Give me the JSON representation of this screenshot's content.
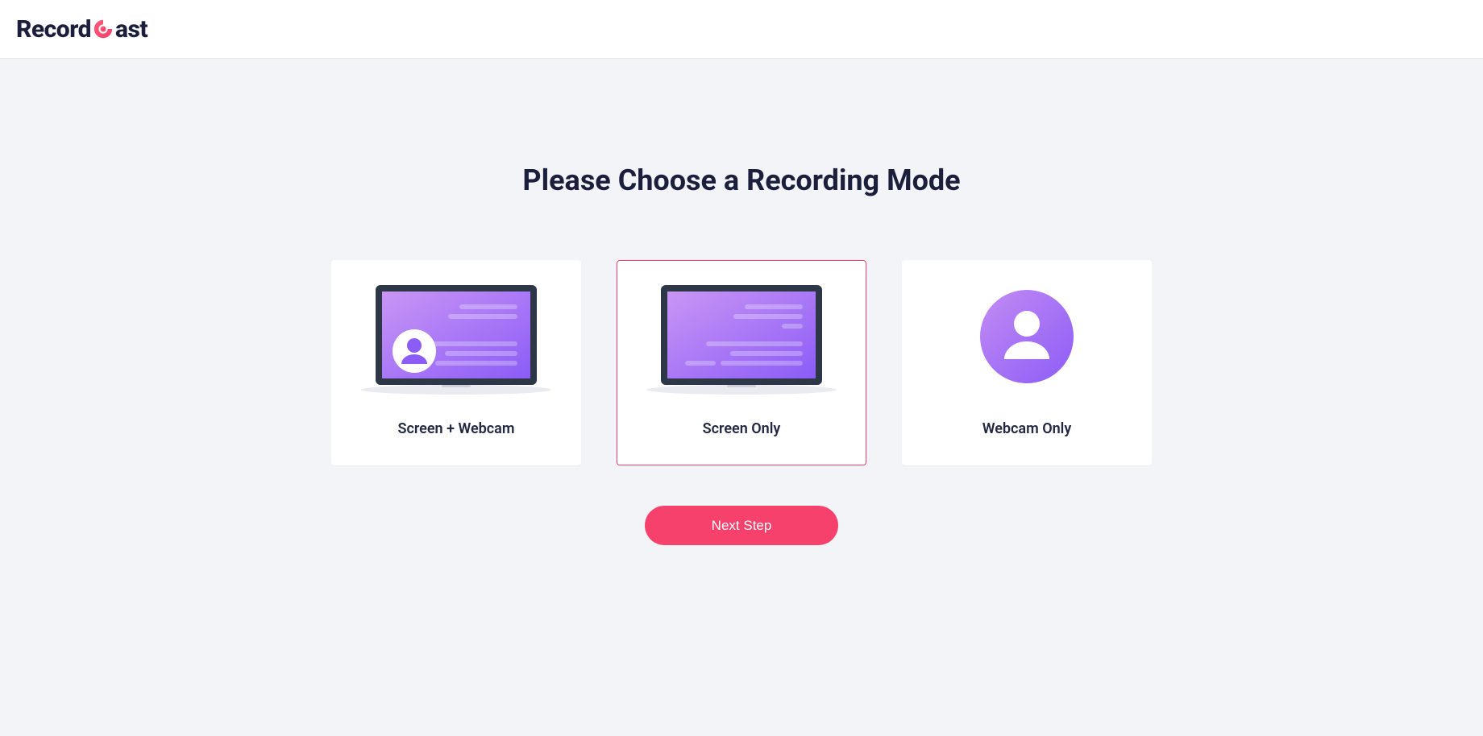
{
  "logo": {
    "part1": "Record",
    "part2": "ast"
  },
  "title": "Please Choose a Recording Mode",
  "options": [
    {
      "label": "Screen + Webcam",
      "selected": false
    },
    {
      "label": "Screen Only",
      "selected": true
    },
    {
      "label": "Webcam Only",
      "selected": false
    }
  ],
  "next_button": "Next Step",
  "colors": {
    "accent": "#f6416c",
    "screen_purple_light": "#c38cf4",
    "screen_purple_dark": "#8b5cf6"
  }
}
